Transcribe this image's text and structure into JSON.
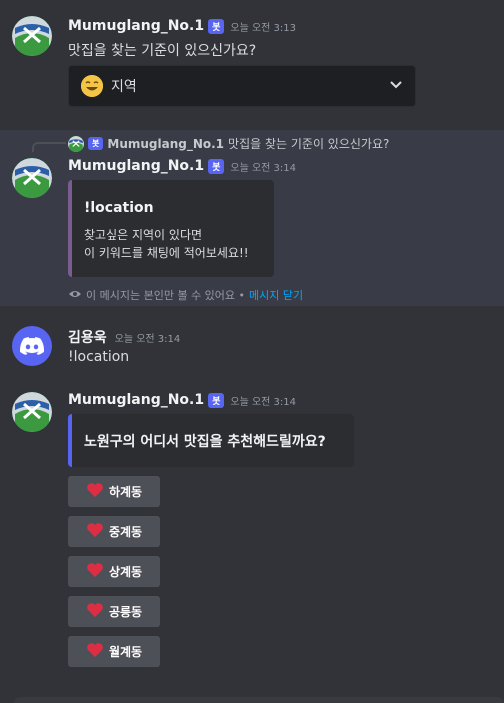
{
  "bot": {
    "name": "Mumuglang_No.1",
    "tag": "봇"
  },
  "msg1": {
    "time": "오늘 오전 3:13",
    "text": "맛집을 찾는 기준이 있으신가요?"
  },
  "select": {
    "emoji": "smile-emoji",
    "value": "지역"
  },
  "reply": {
    "text": "맛집을 찾는 기준이 있으신가요?"
  },
  "msg2": {
    "time": "오늘 오전 3:14",
    "embed_title": "!location",
    "embed_line1": "찾고싶은 지역이 있다면",
    "embed_line2": "이 키워드를 채팅에 적어보세요!!",
    "ephemeral_text": "이 메시지는 본인만 볼 수 있어요 •",
    "dismiss": "메시지 닫기"
  },
  "msg3": {
    "user": "김용욱",
    "time": "오늘 오전 3:14",
    "text": "!location"
  },
  "msg4": {
    "time": "오늘 오전 3:14",
    "embed_title": "노원구의 어디서 맛집을 추천해드릴까요?",
    "buttons": [
      "하계동",
      "중계동",
      "상계동",
      "공릉동",
      "월계동"
    ]
  },
  "colors": {
    "background": "#313338",
    "blurple": "#5865f2",
    "link": "#00a8fc",
    "heart": "#dd2e44"
  }
}
